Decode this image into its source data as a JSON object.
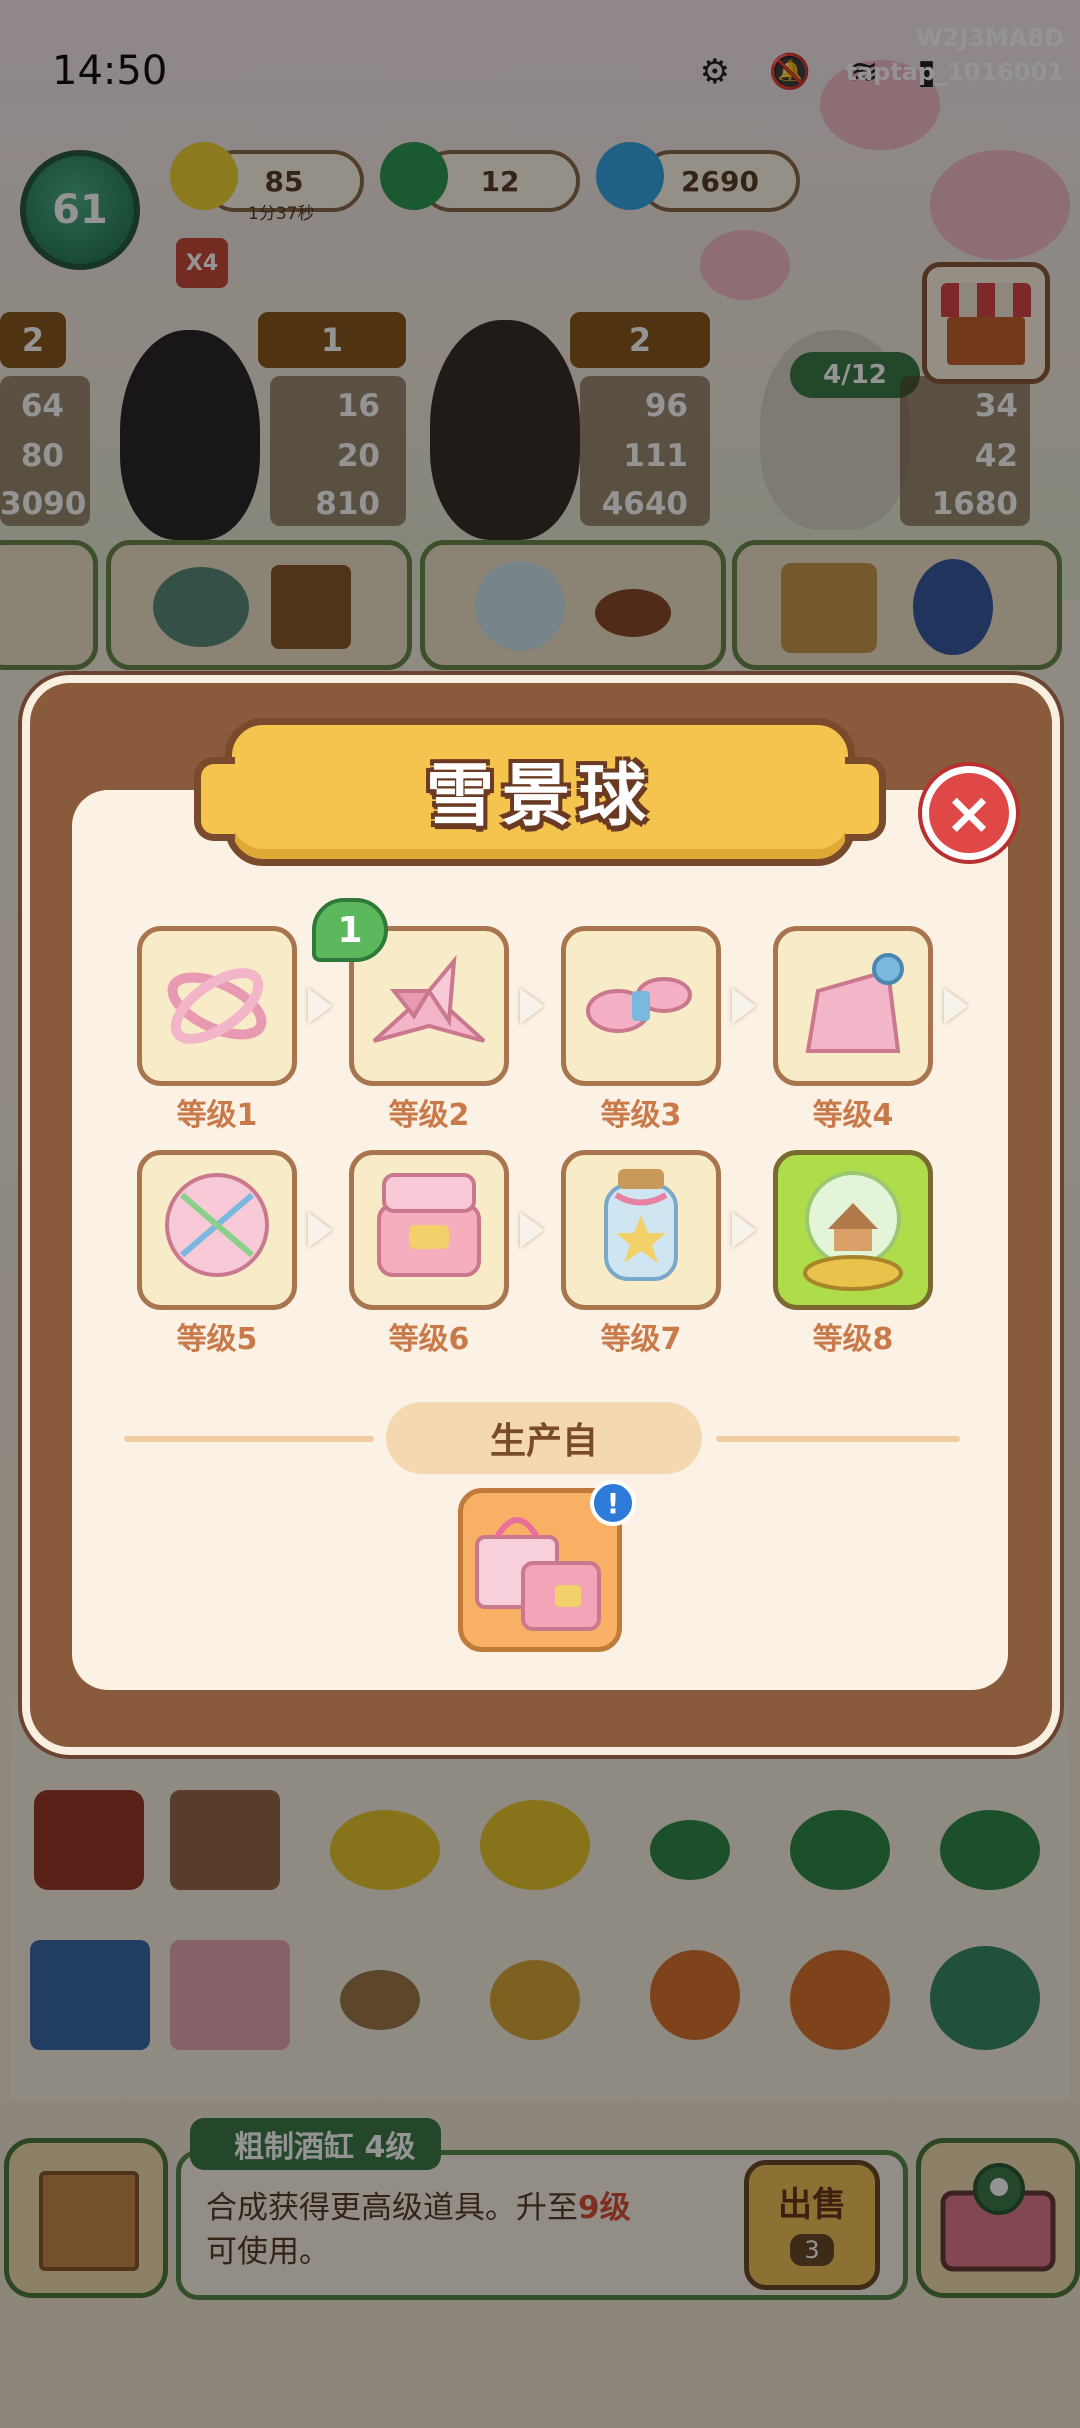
{
  "status_bar": {
    "time": "14:50",
    "icons": "⚙ 🔕 ≋ ▮",
    "overlay_id_1": "W2J3MA8D",
    "overlay_id_2": "taptap_1016001"
  },
  "resources": {
    "player_level": "61",
    "energy": "85",
    "energy_timer": "1分37秒",
    "coins": "12",
    "flames": "2690",
    "multiplier": "X4"
  },
  "customers": [
    {
      "count": "2",
      "stats": [
        "64",
        "80",
        "3090"
      ]
    },
    {
      "count": "1",
      "stats": [
        "16",
        "20",
        "810"
      ]
    },
    {
      "count": "2",
      "stats": [
        "96",
        "111",
        "4640"
      ]
    },
    {
      "count": "",
      "stats": [
        "34",
        "42",
        "1680"
      ]
    }
  ],
  "order_progress": "4/12",
  "modal": {
    "title": "雪景球",
    "close_icon": "×",
    "levels": [
      {
        "label": "等级1",
        "icon": "ring-charm-icon"
      },
      {
        "label": "等级2",
        "icon": "paper-crane-icon"
      },
      {
        "label": "等级3",
        "icon": "thread-bundle-icon"
      },
      {
        "label": "等级4",
        "icon": "tassel-icon"
      },
      {
        "label": "等级5",
        "icon": "woven-disc-icon"
      },
      {
        "label": "等级6",
        "icon": "jewelry-box-icon"
      },
      {
        "label": "等级7",
        "icon": "star-jar-icon"
      },
      {
        "label": "等级8",
        "icon": "snow-globe-icon"
      }
    ],
    "new_count": "1",
    "produced_from_label": "生产自",
    "info_badge": "!"
  },
  "bottom_panel": {
    "item_name": "粗制酒缸 4级",
    "desc_line1_prefix": "合成获得更高级道具。升至",
    "desc_line1_level": "9级",
    "desc_line2": "可使用。",
    "sell_label": "出售",
    "sell_price": "3"
  },
  "colors": {
    "accent_gold": "#f4c44e",
    "frame_brown": "#8a5a3c",
    "current_level_green": "#aedc4a",
    "label_orange": "#c97a4a"
  }
}
